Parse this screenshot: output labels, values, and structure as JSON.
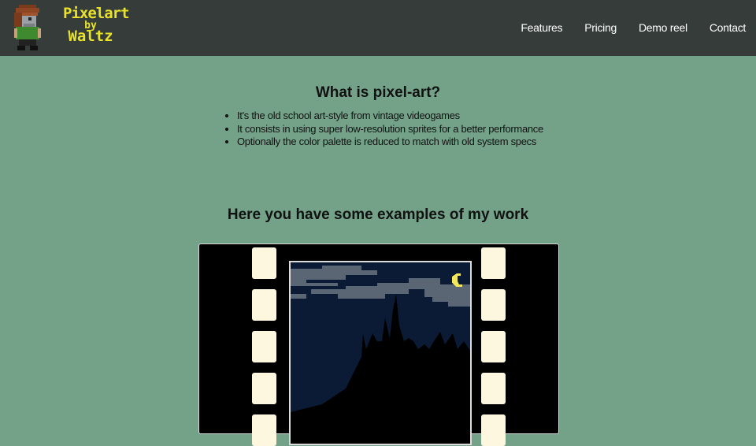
{
  "nav": {
    "logo_lines": [
      "Pixelart",
      "by",
      "Waltz"
    ],
    "links": [
      "Features",
      "Pricing",
      "Demo reel",
      "Contact"
    ]
  },
  "intro": {
    "title": "What is pixel-art?",
    "items": [
      "It's the old school art-style from vintage videogames",
      "It consists in using super low-resolution sprites for a better performance",
      "Optionally the color palette is reduced to match with old system specs"
    ]
  },
  "examples": {
    "title": "Here you have some examples of my work"
  },
  "colors": {
    "page_background": "#73a289",
    "navbar_background": "#353c3a",
    "logo_yellow": "#e8e229",
    "film_black": "#000000",
    "film_hole": "#fdf7e0",
    "night_sky": "#0b1b36",
    "cloud": "#5a6673",
    "moon": "#f2e75a"
  }
}
